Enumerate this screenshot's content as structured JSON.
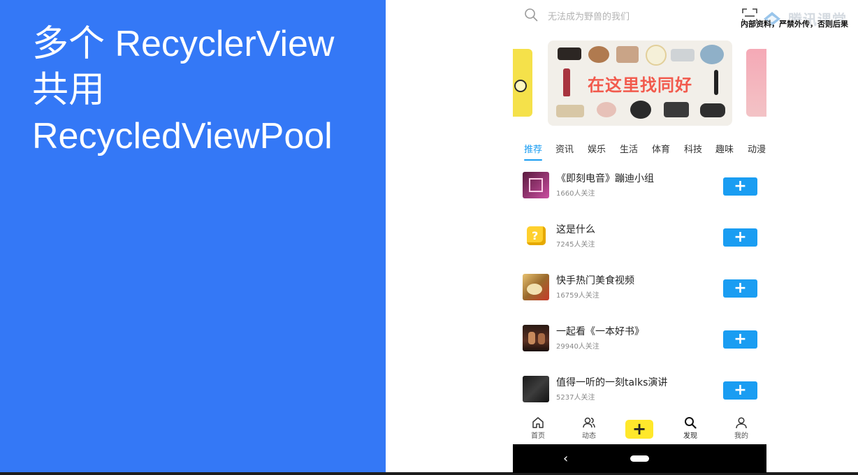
{
  "slide": {
    "title_lines": [
      "多个 RecyclerView",
      "共用",
      "RecycledViewPool"
    ],
    "colors": {
      "background": "#3478f6",
      "text": "#ffffff"
    }
  },
  "watermark": {
    "brand": "腾讯课堂",
    "notice": "内部资料，严禁外传，否则后果"
  },
  "app": {
    "search": {
      "placeholder": "无法成为野兽的我们"
    },
    "banner": {
      "slogan": "在这里找同好"
    },
    "tabs": [
      {
        "label": "推荐",
        "active": true
      },
      {
        "label": "资讯",
        "active": false
      },
      {
        "label": "娱乐",
        "active": false
      },
      {
        "label": "生活",
        "active": false
      },
      {
        "label": "体育",
        "active": false
      },
      {
        "label": "科技",
        "active": false
      },
      {
        "label": "趣味",
        "active": false
      },
      {
        "label": "动漫",
        "active": false
      }
    ],
    "groups": [
      {
        "name": "《即刻电音》蹦迪小组",
        "followers": "1660人关注",
        "action": "+"
      },
      {
        "name": "这是什么",
        "followers": "7245人关注",
        "action": "+"
      },
      {
        "name": "快手热门美食视频",
        "followers": "16759人关注",
        "action": "+"
      },
      {
        "name": "一起看《一本好书》",
        "followers": "29940人关注",
        "action": "+"
      },
      {
        "name": "值得一听的一刻talks演讲",
        "followers": "5237人关注",
        "action": "+"
      }
    ],
    "bottom_nav": [
      {
        "label": "首页",
        "icon": "home-icon"
      },
      {
        "label": "动态",
        "icon": "people-icon"
      },
      {
        "label": "+",
        "icon": "plus-icon"
      },
      {
        "label": "发现",
        "icon": "search-icon",
        "active": true
      },
      {
        "label": "我的",
        "icon": "person-icon"
      }
    ],
    "system_nav": {
      "back": "‹"
    },
    "colors": {
      "accent": "#1a9df2",
      "post_button": "#ffe82b",
      "slogan": "#f25a4d"
    }
  }
}
